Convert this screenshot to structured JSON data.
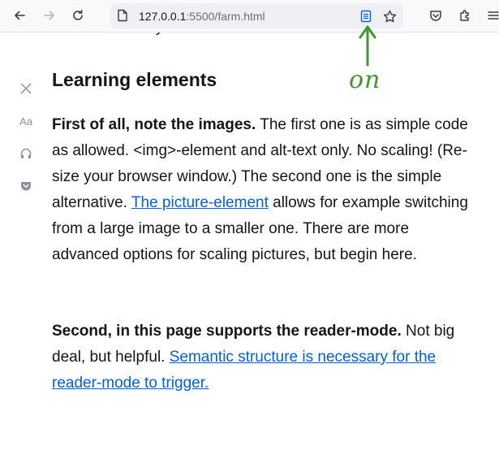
{
  "browser": {
    "url_host": "127.0.0.1",
    "url_rest": ":5500/farm.html"
  },
  "reader_sidebar": {
    "text_settings_label": "Aa"
  },
  "article": {
    "cut_line": "selected and styled.",
    "heading": "Learning elements",
    "p1": {
      "bold": "First of all, note the images.",
      "text1": " The first one is as simple code as allowed. <img>-element and alt-text only. No scaling! (Re-size your browser window.) The second one is the simple alternative. ",
      "link": "The picture-element",
      "text2": " allows for example switching from a large image to a smaller one. There are more advanced options for scaling pictures, but begin here."
    },
    "p2": {
      "bold": "Second, in this page supports the reader-mode.",
      "text1": " Not big deal, but helpful. ",
      "link": "Semantic structure is necessary for the reader-mode to trigger."
    }
  },
  "annotation": {
    "text": "on",
    "color": "#3c9a2c"
  }
}
